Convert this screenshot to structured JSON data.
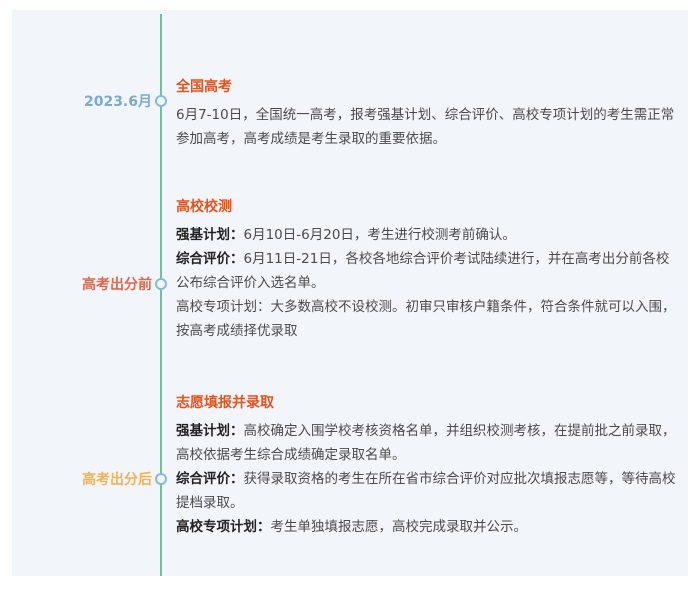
{
  "colors": {
    "line": "#6cc29a",
    "node": "#86b8dd",
    "title": "#e8521c",
    "stage1": "#7aa9d8",
    "stage2": "#e0674a",
    "stage3": "#f0b35b"
  },
  "stages": [
    {
      "label": "2023.6月",
      "title": "全国高考",
      "paras": [
        {
          "key": "",
          "text": "6月7-10日，全国统一高考，报考强基计划、综合评价、高校专项计划的考生需正常参加高考，高考成绩是考生录取的重要依据。"
        }
      ]
    },
    {
      "label": "高考出分前",
      "title": "高校校测",
      "paras": [
        {
          "key": "强基计划：",
          "text": "6月10日-6月20日，考生进行校测考前确认。"
        },
        {
          "key": "综合评价：",
          "text": "6月11日-21日，各校各地综合评价考试陆续进行，并在高考出分前各校公布综合评价入选名单。"
        },
        {
          "key": "",
          "text": "高校专项计划：大多数高校不设校测。初审只审核户籍条件，符合条件就可以入围，按高考成绩择优录取"
        }
      ]
    },
    {
      "label": "高考出分后",
      "title": "志愿填报并录取",
      "paras": [
        {
          "key": "强基计划：",
          "text": "高校确定入围学校考核资格名单，并组织校测考核，在提前批之前录取，高校依据考生综合成绩确定录取名单。"
        },
        {
          "key": "综合评价：",
          "text": "获得录取资格的考生在所在省市综合评价对应批次填报志愿等，等待高校提档录取。"
        },
        {
          "key": "高校专项计划：",
          "text": "考生单独填报志愿，高校完成录取并公示。"
        }
      ]
    }
  ]
}
